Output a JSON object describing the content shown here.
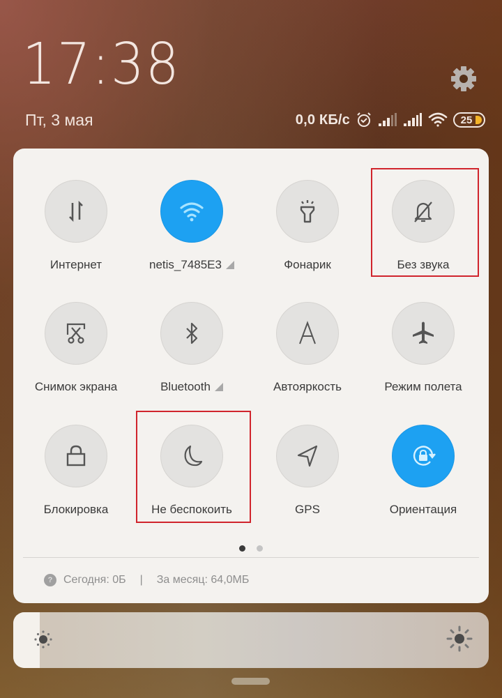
{
  "header": {
    "time": "17:38",
    "date": "Пт, 3 мая",
    "settings_icon": "gear-icon"
  },
  "statusbar": {
    "net_speed": "0,0 КБ/с",
    "icons": [
      "alarm-icon",
      "signal-sim1-icon",
      "signal-sim2-icon",
      "wifi-icon"
    ],
    "battery_level": "25",
    "battery_color": "#f4b429"
  },
  "quick_settings": {
    "accent_color": "#1da1f2",
    "tiles": [
      {
        "label": "Интернет",
        "icon": "mobile-data-icon",
        "active": false,
        "has_menu": false
      },
      {
        "label": "netis_7485E3",
        "icon": "wifi-icon",
        "active": true,
        "has_menu": true
      },
      {
        "label": "Фонарик",
        "icon": "flashlight-icon",
        "active": false,
        "has_menu": false
      },
      {
        "label": "Без звука",
        "icon": "bell-off-icon",
        "active": false,
        "has_menu": false,
        "highlighted": true
      },
      {
        "label": "Снимок экрана",
        "icon": "screenshot-icon",
        "active": false,
        "has_menu": false
      },
      {
        "label": "Bluetooth",
        "icon": "bluetooth-icon",
        "active": false,
        "has_menu": true
      },
      {
        "label": "Автояркость",
        "icon": "auto-brightness-icon",
        "active": false,
        "has_menu": false
      },
      {
        "label": "Режим полета",
        "icon": "airplane-icon",
        "active": false,
        "has_menu": false
      },
      {
        "label": "Блокировка",
        "icon": "lock-icon",
        "active": false,
        "has_menu": false
      },
      {
        "label": "Не беспокоить",
        "icon": "moon-icon",
        "active": false,
        "has_menu": false,
        "highlighted": true
      },
      {
        "label": "GPS",
        "icon": "location-arrow-icon",
        "active": false,
        "has_menu": false
      },
      {
        "label": "Ориентация",
        "icon": "rotation-lock-icon",
        "active": true,
        "has_menu": false
      }
    ],
    "page_indicator": {
      "current": 1,
      "total": 2
    },
    "highlight_color": "#d0242c"
  },
  "data_usage": {
    "help_icon": "?",
    "today": "Сегодня: 0Б",
    "separator": "|",
    "month": "За месяц: 64,0МБ"
  },
  "brightness": {
    "level_fraction": 0.055
  }
}
